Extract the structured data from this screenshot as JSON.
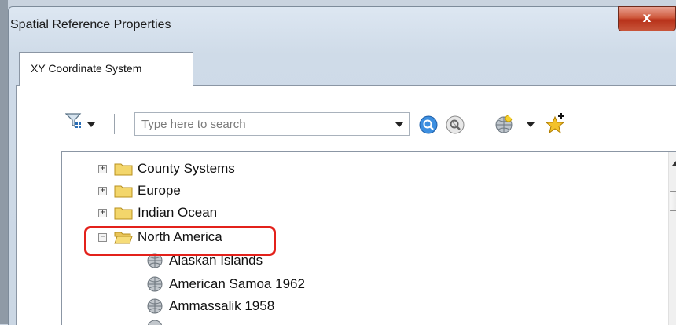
{
  "window": {
    "title": "Spatial Reference Properties",
    "close_label": "x"
  },
  "tabs": [
    {
      "label": "XY Coordinate System"
    }
  ],
  "toolbar": {
    "search_placeholder": "Type here to search"
  },
  "tree": {
    "folders": [
      {
        "label": "County Systems",
        "expander": "+"
      },
      {
        "label": "Europe",
        "expander": "+"
      },
      {
        "label": "Indian Ocean",
        "expander": "+"
      },
      {
        "label": "North America",
        "expander": "−"
      }
    ],
    "items": [
      {
        "label": "Alaskan Islands"
      },
      {
        "label": "American Samoa 1962"
      },
      {
        "label": "Ammassalik 1958"
      }
    ]
  },
  "colors": {
    "highlight": "#e3211b",
    "folder": "#f3d66b",
    "close": "#c8553a"
  },
  "icons": [
    "filter-icon",
    "search-icon",
    "clear-search-icon",
    "globe-icon",
    "new-favorite-icon",
    "folder-icon",
    "coordinate-system-globe-icon"
  ]
}
